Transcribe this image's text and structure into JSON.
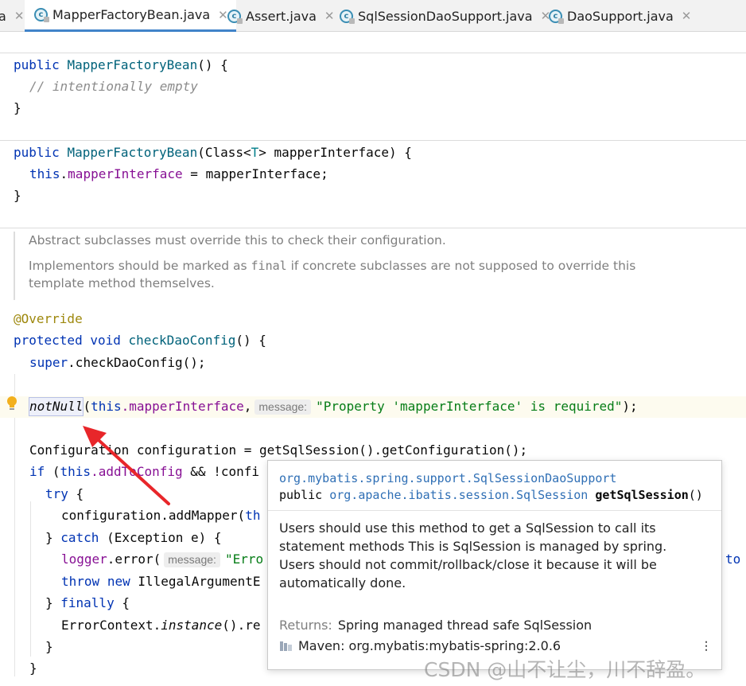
{
  "tabs": [
    {
      "label": "a",
      "partial": true
    },
    {
      "label": "MapperFactoryBean.java",
      "icon": "class-file-icon",
      "active": true
    },
    {
      "label": "Assert.java",
      "icon": "class-file-icon"
    },
    {
      "label": "SqlSessionDaoSupport.java",
      "icon": "class-file-icon"
    },
    {
      "label": "DaoSupport.java",
      "icon": "class-file-icon"
    }
  ],
  "code": {
    "ctor1": {
      "kw": "public",
      "name": "MapperFactoryBean",
      "rest": "() {",
      "comment": "// intentionally empty",
      "close": "}"
    },
    "ctor2": {
      "kw": "public",
      "name": "MapperFactoryBean",
      "params": "(Class<",
      "typ": "T",
      "params2": "> mapperInterface) {",
      "this": "this",
      "field": "mapperInterface",
      "assign": " = mapperInterface;",
      "close": "}"
    },
    "doc": {
      "p1": "Abstract subclasses must override this to check their configuration.",
      "p2a": "Implementors should be marked as ",
      "p2code": "final",
      "p2b": " if concrete subclasses are not supposed to override this template method themselves."
    },
    "annotation": "@Override",
    "method_sig": {
      "kw1": "protected",
      "kw2": "void",
      "name": "checkDaoConfig",
      "rest": "() {"
    },
    "super_call": {
      "kw": "super",
      "rest": ".checkDaoConfig();"
    },
    "notnull": {
      "name": "notNull",
      "open": "(",
      "this": "this",
      "field": ".mapperInterface",
      "comma": ",",
      "hint": "message:",
      "str": "\"Property 'mapperInterface' is required\"",
      "end": ");"
    },
    "config_line": "Configuration configuration = getSqlSession().getConfiguration();",
    "if_line": {
      "kw": "if",
      "open": " (",
      "this": "this",
      "field": ".addToConfig",
      "rest": " && !confi"
    },
    "try_kw": "try",
    "try_line": {
      "kw": "try",
      "rest": " {"
    },
    "add_mapper": {
      "text": "configuration.addMapper(",
      "trail": "th"
    },
    "catch_line": {
      "close": "} ",
      "kw": "catch",
      "rest": " (Exception e) {"
    },
    "logger_line": {
      "field": "logger",
      "call": ".error(",
      "hint": "message:",
      "str": "\"Erro"
    },
    "throw_line": {
      "kw1": "throw",
      "kw2": "new",
      "rest": " IllegalArgumentE"
    },
    "finally_line": {
      "close": "} ",
      "kw": "finally",
      "rest": " {"
    },
    "errctx_line": {
      "a": "ErrorContext.",
      "b": "instance",
      "c": "().re"
    },
    "brace": "}",
    "overflow": "to"
  },
  "popup": {
    "class_path": "org.mybatis.spring.support.SqlSessionDaoSupport",
    "sig_kw": "public",
    "sig_type": "org.apache.ibatis.session.SqlSession",
    "sig_name": "getSqlSession",
    "sig_rest": "()",
    "description": "Users should use this method to get a SqlSession to call its statement methods This is SqlSession is managed by spring. Users should not commit/rollback/close it because it will be automatically done.",
    "returns_label": "Returns:",
    "returns_value": "Spring managed thread safe SqlSession",
    "maven": "Maven: org.mybatis:mybatis-spring:2.0.6",
    "more": "⋮"
  },
  "watermark": "CSDN @山不让尘，川不辞盈。",
  "colors": {
    "accent": "#4083c9",
    "keyword": "#0033b3",
    "string": "#067d17",
    "field": "#871094",
    "arrow": "#e8262a"
  }
}
